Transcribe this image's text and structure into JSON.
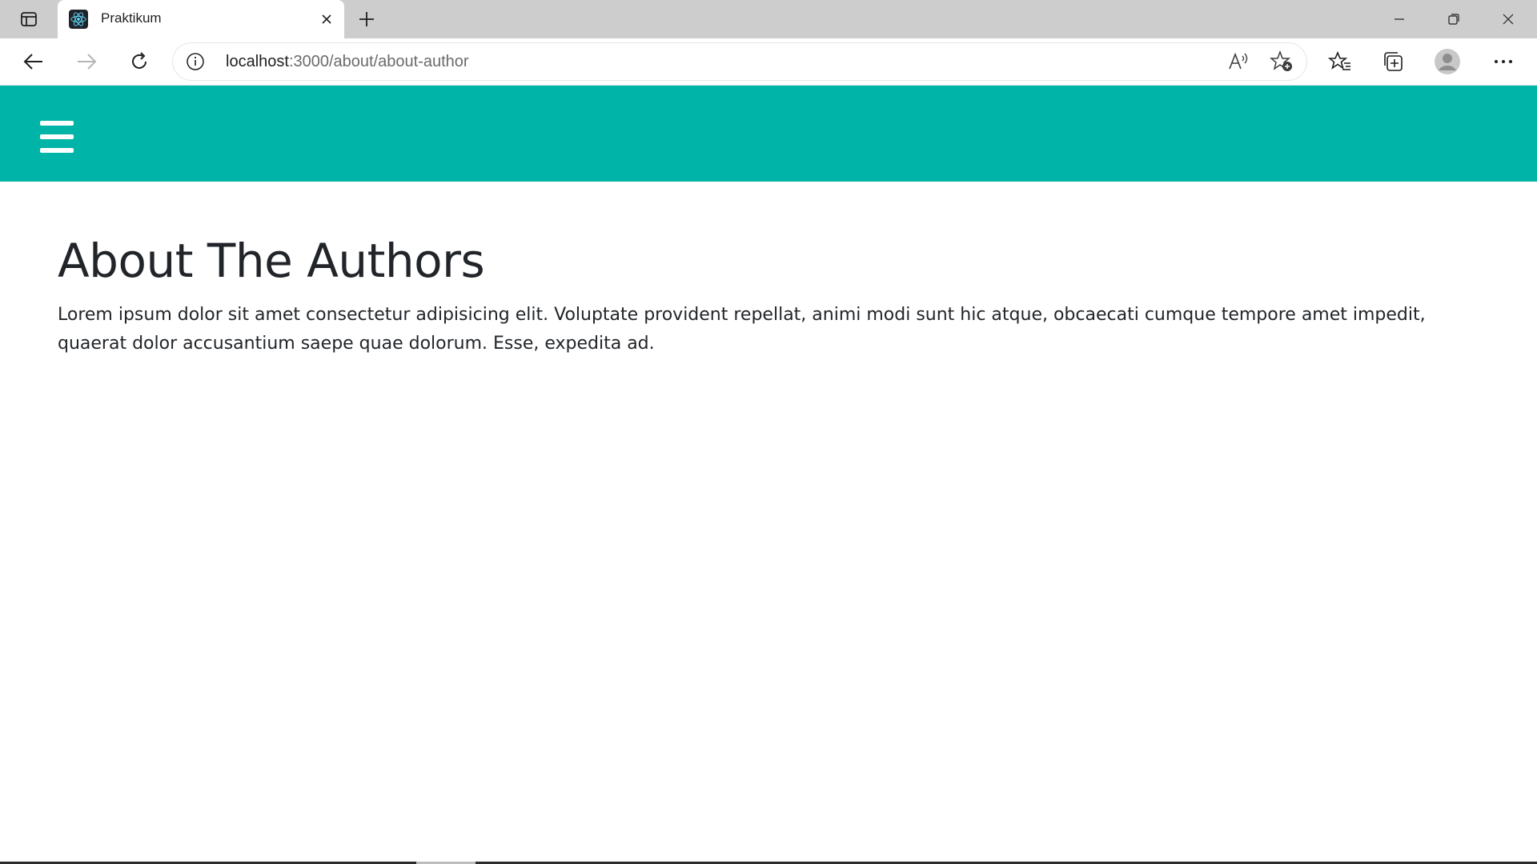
{
  "browser": {
    "tab": {
      "title": "Praktikum",
      "favicon": "react-logo-icon"
    },
    "url": {
      "host": "localhost",
      "rest": ":3000/about/about-author"
    },
    "icons": {
      "tab_actions": "tab-actions-icon",
      "close_tab": "close-icon",
      "new_tab": "plus-icon",
      "minimize": "minimize-icon",
      "restore": "restore-icon",
      "close_window": "close-icon",
      "back": "arrow-left-icon",
      "forward": "arrow-right-icon",
      "refresh": "refresh-icon",
      "site_info": "info-icon",
      "read_aloud": "read-aloud-icon",
      "add_favorite": "star-add-icon",
      "favorites": "favorites-icon",
      "collections": "collections-icon",
      "profile": "profile-icon",
      "more": "more-icon"
    }
  },
  "page": {
    "navbar": {
      "color": "#00b5a7",
      "menu_icon": "hamburger-menu-icon"
    },
    "title": "About The Authors",
    "body": "Lorem ipsum dolor sit amet consectetur adipisicing elit. Voluptate provident repellat, animi modi sunt hic atque, obcaecati cumque tempore amet impedit, quaerat dolor accusantium saepe quae dolorum. Esse, expedita ad."
  }
}
